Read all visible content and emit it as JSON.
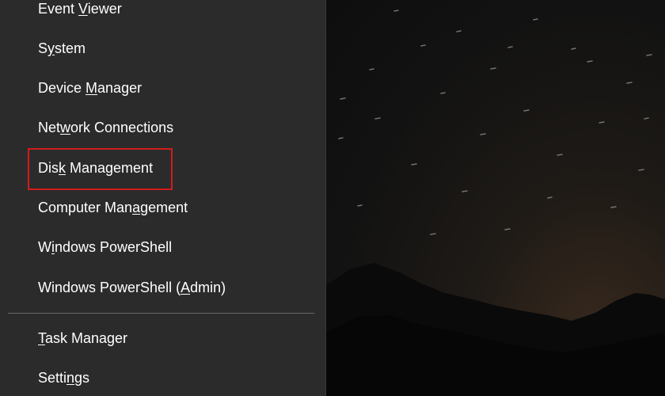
{
  "context_menu": {
    "items": [
      {
        "pre": "Event ",
        "ul": "V",
        "post": "iewer"
      },
      {
        "pre": "S",
        "ul": "y",
        "post": "stem"
      },
      {
        "pre": "Device ",
        "ul": "M",
        "post": "anager"
      },
      {
        "pre": "Net",
        "ul": "w",
        "post": "ork Connections"
      },
      {
        "pre": "Dis",
        "ul": "k",
        "post": " Management"
      },
      {
        "pre": "Computer Man",
        "ul": "a",
        "post": "gement"
      },
      {
        "pre": "W",
        "ul": "i",
        "post": "ndows PowerShell"
      },
      {
        "pre": "Windows PowerShell (",
        "ul": "A",
        "post": "dmin)"
      },
      {
        "pre": "",
        "ul": "T",
        "post": "ask Manager"
      },
      {
        "pre": "Setti",
        "ul": "n",
        "post": "gs"
      }
    ],
    "highlighted_item": "Disk Management",
    "highlight_color": "#d01c1c",
    "background_color": "#2b2b2b"
  },
  "desktop": {
    "wallpaper": "night sky with star trails over mountains"
  }
}
